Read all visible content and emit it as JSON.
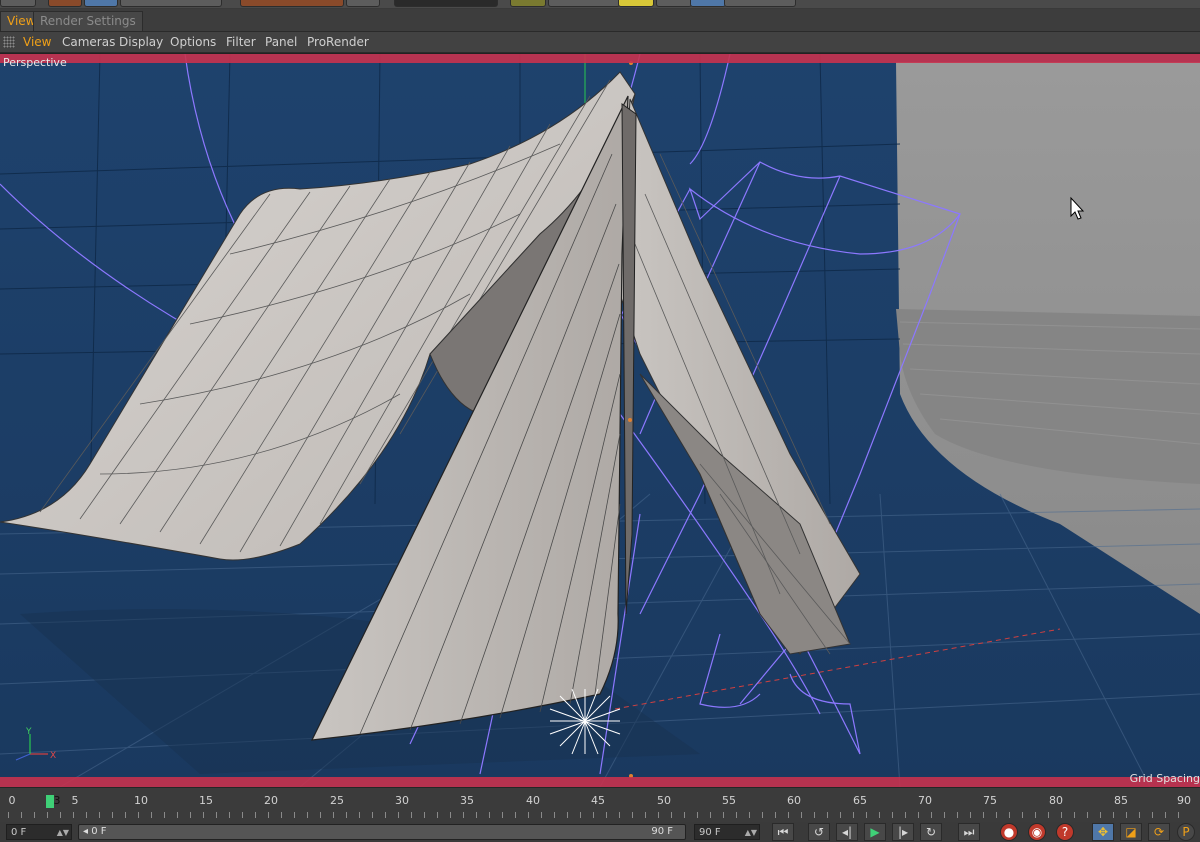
{
  "tabs": [
    {
      "label": "View",
      "active": true
    },
    {
      "label": "Render Settings",
      "active": false
    }
  ],
  "menu": [
    "View",
    "Cameras",
    "Display",
    "Options",
    "Filter",
    "Panel",
    "ProRender"
  ],
  "viewport": {
    "projection_label": "Perspective",
    "grid_label": "Grid Spacing",
    "axis_x": "X",
    "axis_y": "Y",
    "colors": {
      "background": "#1d3e66",
      "safe_frame": "#c8324e",
      "spline": "#8c78ff"
    }
  },
  "timeline": {
    "ruler_labels": [
      "0",
      "5",
      "10",
      "15",
      "20",
      "25",
      "30",
      "35",
      "40",
      "45",
      "50",
      "55",
      "60",
      "65",
      "70",
      "75",
      "80",
      "85",
      "90"
    ],
    "current_frame_label": "3",
    "start_field": "0 F",
    "range_start": "0 F",
    "range_end": "90 F",
    "end_field": "90 F"
  },
  "playback_icons": [
    "go-start-icon",
    "prev-key-icon",
    "step-back-icon",
    "play-icon",
    "step-forward-icon",
    "next-key-icon",
    "go-end-icon"
  ],
  "key_icons": [
    "record-icon",
    "autokey-icon",
    "keyframe-help-icon"
  ],
  "key_glyphs": [
    "?",
    "P"
  ]
}
